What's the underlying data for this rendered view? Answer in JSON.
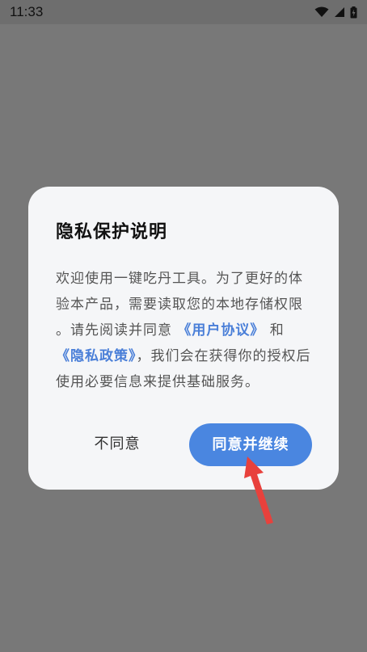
{
  "status_bar": {
    "time": "11:33",
    "icons": [
      "wifi-icon",
      "signal-icon",
      "battery-charging-icon"
    ]
  },
  "dialog": {
    "title": "隐私保护说明",
    "body_part1": "欢迎使用一键吃丹工具。为了更好的体验本产品，需要读取您的本地存储权限 。请先阅读并同意 ",
    "user_agreement_link": "《用户协议》",
    "body_part2": " 和 ",
    "privacy_policy_link": "《隐私政策》",
    "body_part3": "，我们会在获得你的授权后使用必要信息来提供基础服务。",
    "disagree_label": "不同意",
    "agree_label": "同意并继续"
  },
  "colors": {
    "overlay": "#787878",
    "dialog_bg": "#f5f6f8",
    "accent": "#4a86e0",
    "link": "#4a7fd8",
    "annotation_arrow": "#e8413c"
  }
}
